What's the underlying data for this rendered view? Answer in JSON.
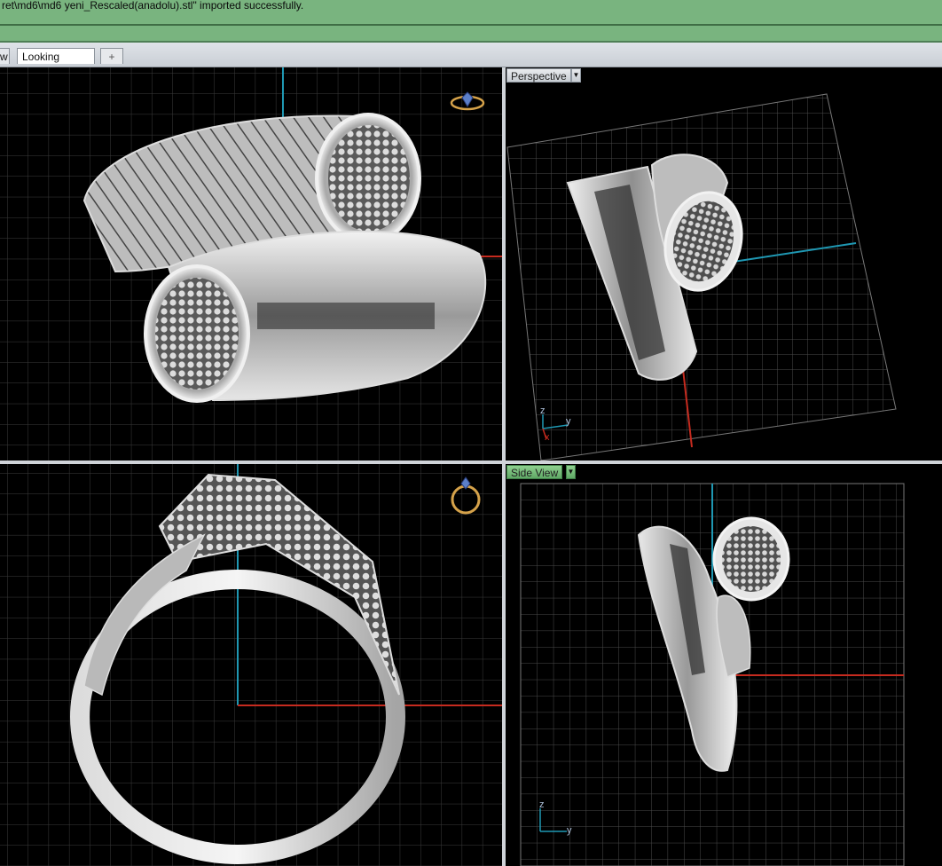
{
  "command_bar": {
    "message": "ret\\md6\\md6 yeni_Rescaled(anadolu).stl\" imported successfully."
  },
  "tabs": {
    "prev_label": "w",
    "active_label": "Looking Down",
    "add_label": "+"
  },
  "viewports": {
    "perspective": {
      "label": "Perspective",
      "dropdown": "▼"
    },
    "side": {
      "label": "Side View",
      "dropdown": "▼"
    }
  },
  "axis_widget": {
    "z": "z",
    "y": "y",
    "x": "x"
  },
  "colors": {
    "grid": "#3a3a3a",
    "axis_red": "#c62b1f",
    "axis_blue": "#1f98b3",
    "command_bar": "#79b47f",
    "metal": "#c9c9c9"
  },
  "icons": {
    "top_right_ring": "ring-orientation-icon",
    "front_ring": "ring-front-icon",
    "axis_triad": "axis-triad-icon"
  }
}
